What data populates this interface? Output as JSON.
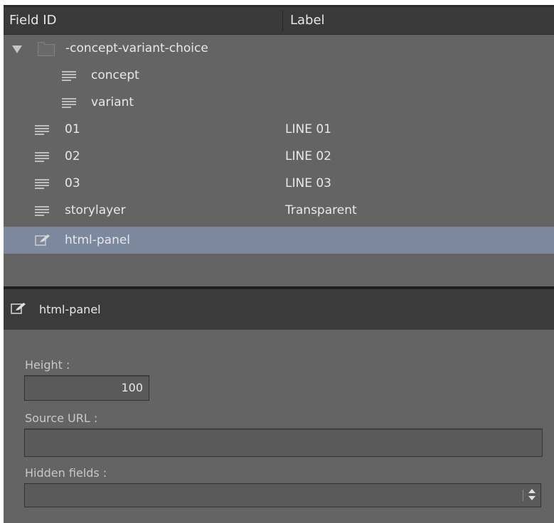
{
  "columns": {
    "field_id": "Field ID",
    "label": "Label"
  },
  "tree": {
    "group_name": "-concept-variant-choice",
    "children": [
      {
        "name": "concept"
      },
      {
        "name": "variant"
      }
    ],
    "rows": [
      {
        "field": "01",
        "label": "LINE 01"
      },
      {
        "field": "02",
        "label": "LINE 02"
      },
      {
        "field": "03",
        "label": "LINE 03"
      },
      {
        "field": "storylayer",
        "label": "Transparent"
      }
    ],
    "selected": {
      "field": "html-panel",
      "icon": "edit-icon"
    }
  },
  "panel": {
    "title": "html-panel",
    "height_label": "Height :",
    "height_value": "100",
    "source_url_label": "Source URL :",
    "source_url_value": "",
    "hidden_fields_label": "Hidden fields :",
    "hidden_fields_value": ""
  },
  "colors": {
    "background": "#646464",
    "header": "#3a3a3a",
    "selected_row": "#7b889d"
  }
}
